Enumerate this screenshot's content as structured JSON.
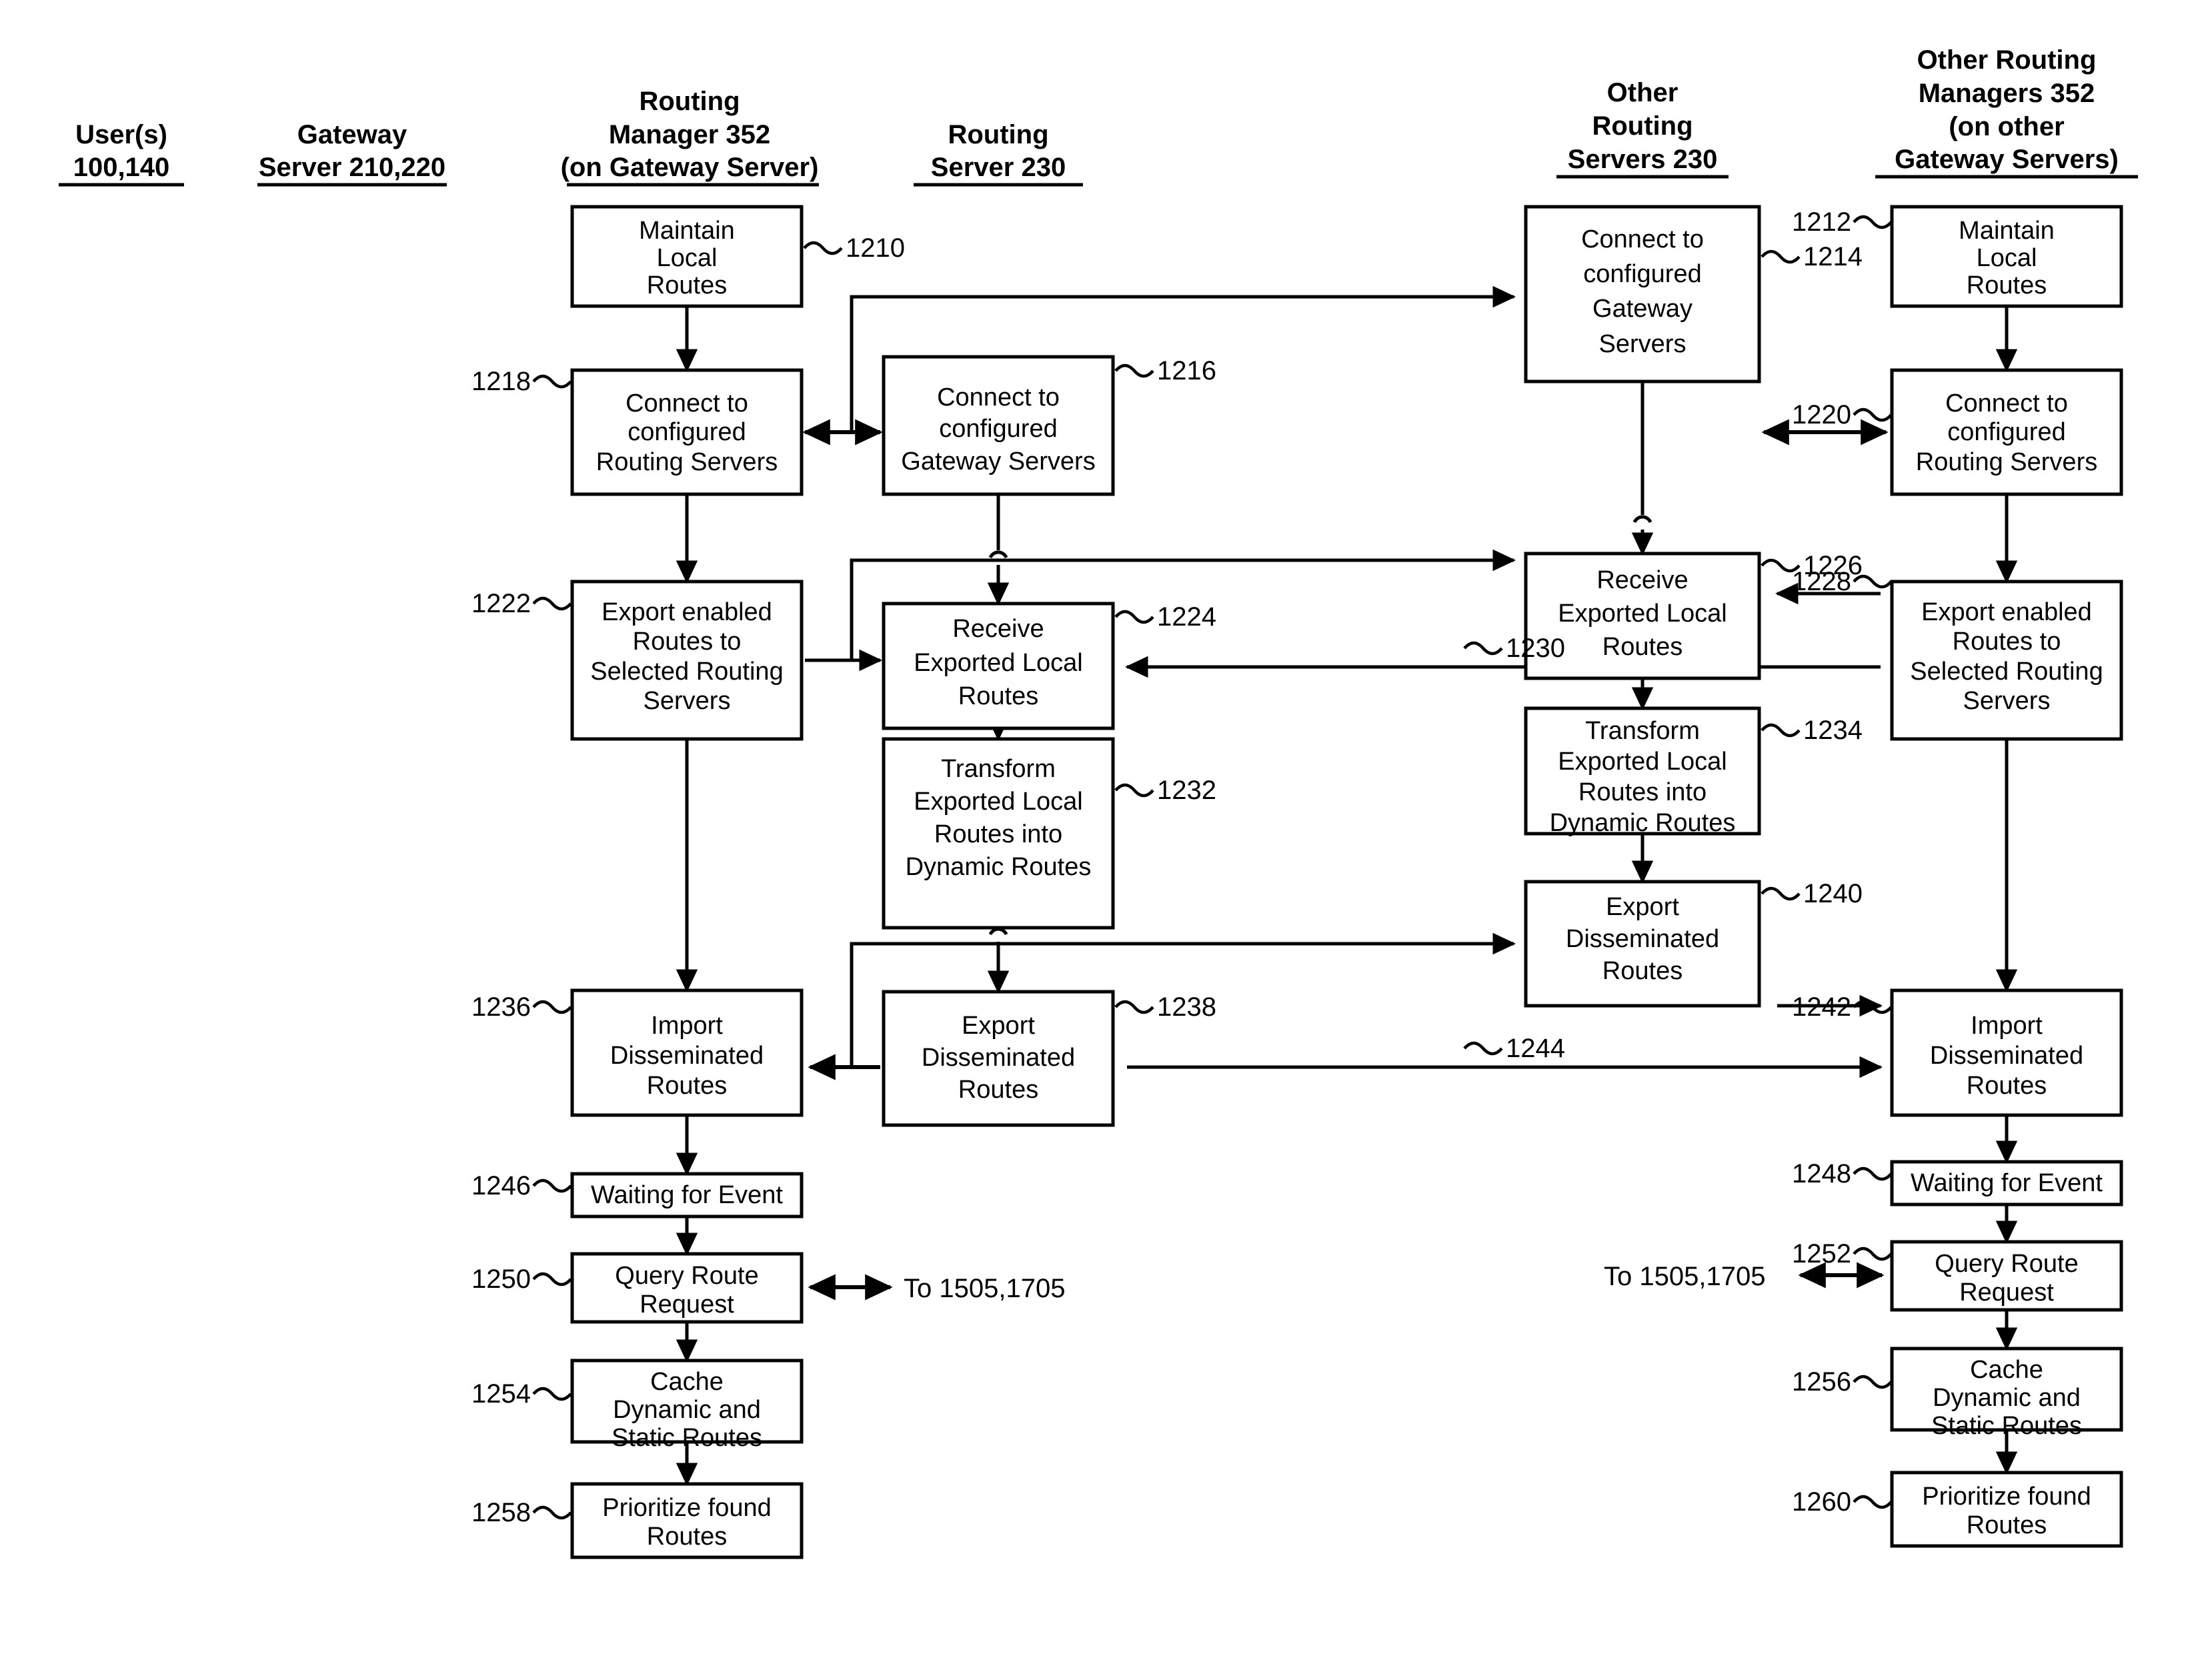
{
  "figure": {
    "columns": [
      {
        "id": "users",
        "lines": [
          "User(s)",
          "100,140"
        ]
      },
      {
        "id": "gateway",
        "lines": [
          "Gateway",
          "Server 210,220"
        ]
      },
      {
        "id": "routing-mgr",
        "lines": [
          "Routing",
          "Manager 352",
          "(on Gateway Server)"
        ]
      },
      {
        "id": "routing-srv",
        "lines": [
          "Routing",
          "Server 230"
        ]
      },
      {
        "id": "other-routing-servers",
        "lines": [
          "Other",
          "Routing",
          "Servers 230"
        ]
      },
      {
        "id": "other-routing-managers",
        "lines": [
          "Other Routing",
          "Managers 352",
          "(on other",
          "Gateway Servers)"
        ]
      }
    ],
    "boxes": [
      {
        "ref": "1210",
        "lines": [
          "Maintain",
          "Local",
          "Routes"
        ]
      },
      {
        "ref": "1218",
        "lines": [
          "Connect to",
          "configured",
          "Routing Servers"
        ]
      },
      {
        "ref": "1222",
        "lines": [
          "Export enabled",
          "Routes to",
          "Selected Routing",
          "Servers"
        ]
      },
      {
        "ref": "1236",
        "lines": [
          "Import",
          "Disseminated",
          "Routes"
        ]
      },
      {
        "ref": "1246",
        "lines": [
          "Waiting for Event"
        ]
      },
      {
        "ref": "1250",
        "lines": [
          "Query Route",
          "Request"
        ]
      },
      {
        "ref": "1254",
        "lines": [
          "Cache",
          "Dynamic and",
          "Static Routes"
        ]
      },
      {
        "ref": "1258",
        "lines": [
          "Prioritize found",
          "Routes"
        ]
      },
      {
        "ref": "1216",
        "lines": [
          "Connect to",
          "configured",
          "Gateway Servers"
        ]
      },
      {
        "ref": "1224",
        "lines": [
          "Receive",
          "Exported Local",
          "Routes"
        ]
      },
      {
        "ref": "1232",
        "lines": [
          "Transform",
          "Exported Local",
          "Routes into",
          "Dynamic Routes"
        ]
      },
      {
        "ref": "1238",
        "lines": [
          "Export",
          "Disseminated",
          "Routes"
        ]
      },
      {
        "ref": "1214",
        "lines": [
          "Connect to",
          "configured",
          "Gateway",
          "Servers"
        ]
      },
      {
        "ref": "1226",
        "lines": [
          "Receive",
          "Exported Local",
          "Routes"
        ]
      },
      {
        "ref": "1234",
        "lines": [
          "Transform",
          "Exported Local",
          "Routes into",
          "Dynamic Routes"
        ]
      },
      {
        "ref": "1240",
        "lines": [
          "Export",
          "Disseminated",
          "Routes"
        ]
      },
      {
        "ref": "1212",
        "lines": [
          "Maintain",
          "Local",
          "Routes"
        ]
      },
      {
        "ref": "1220",
        "lines": [
          "Connect to",
          "configured",
          "Routing Servers"
        ]
      },
      {
        "ref": "1228",
        "lines": [
          "Export enabled",
          "Routes to",
          "Selected Routing",
          "Servers"
        ]
      },
      {
        "ref": "1242",
        "lines": [
          "Import",
          "Disseminated",
          "Routes"
        ]
      },
      {
        "ref": "1248",
        "lines": [
          "Waiting for Event"
        ]
      },
      {
        "ref": "1252",
        "lines": [
          "Query Route",
          "Request"
        ]
      },
      {
        "ref": "1256",
        "lines": [
          "Cache",
          "Dynamic and",
          "Static Routes"
        ]
      },
      {
        "ref": "1260",
        "lines": [
          "Prioritize found",
          "Routes"
        ]
      }
    ],
    "edge_labels": [
      "1230",
      "1244"
    ],
    "annotations": [
      {
        "id": "to-1505-1705-left",
        "text": "To 1505,1705"
      },
      {
        "id": "to-1505-1705-right",
        "text": "To 1505,1705"
      }
    ],
    "colors": {
      "line": "#000000",
      "fill": "#ffffff",
      "text": "#000000"
    }
  }
}
